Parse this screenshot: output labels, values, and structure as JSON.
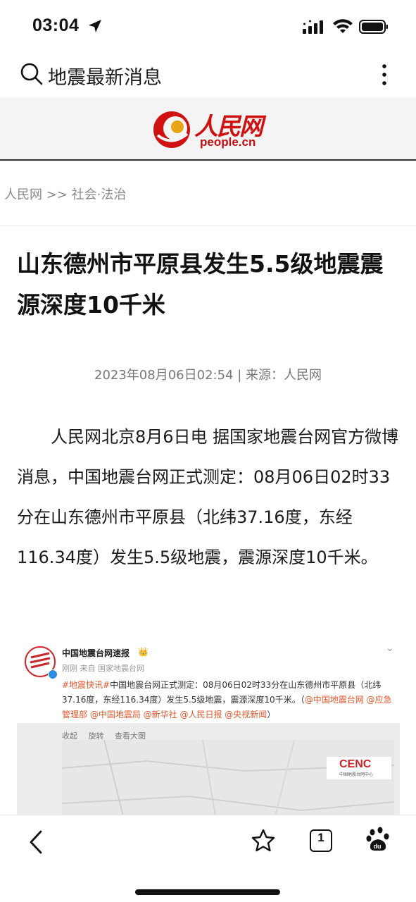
{
  "status_bar": {
    "time": "03:04"
  },
  "search": {
    "query": "地震最新消息"
  },
  "site": {
    "logo_cn": "人民网",
    "logo_en": "people.cn"
  },
  "breadcrumb": "人民网 >> 社会·法治",
  "article": {
    "title": "山东德州市平原县发生5.5级地震震源深度10千米",
    "meta": "2023年08月06日02:54 | 来源：人民网",
    "body": "人民网北京8月6日电 据国家地震台网官方微博消息，中国地震台网正式测定：08月06日02时33分在山东德州市平原县（北纬37.16度，东经116.34度）发生5.5级地震，震源深度10千米。"
  },
  "embed": {
    "account_name": "中国地震台网速报",
    "crown": "👑",
    "sub_line": "刚刚 来自 国家地震台网",
    "hashtag": "#地震快讯#",
    "text": "中国地震台网正式测定：08月06日02时33分在山东德州市平原县（北纬37.16度，东经116.34度）发生5.5级地震，震源深度10千米。（",
    "mentions": "@中国地震台网 @应急管理部 @中国地震局 @新华社 @人民日报 @央视新闻",
    "close_paren": "）",
    "actions": [
      "收起",
      "旋转",
      "查看大图"
    ],
    "map_brand": "CENC",
    "map_brand_sub": "中国地震台网中心"
  },
  "toolbar": {
    "tab_count": "1"
  },
  "colors": {
    "brand_red": "#d01111",
    "link_orange": "#e0562b"
  }
}
